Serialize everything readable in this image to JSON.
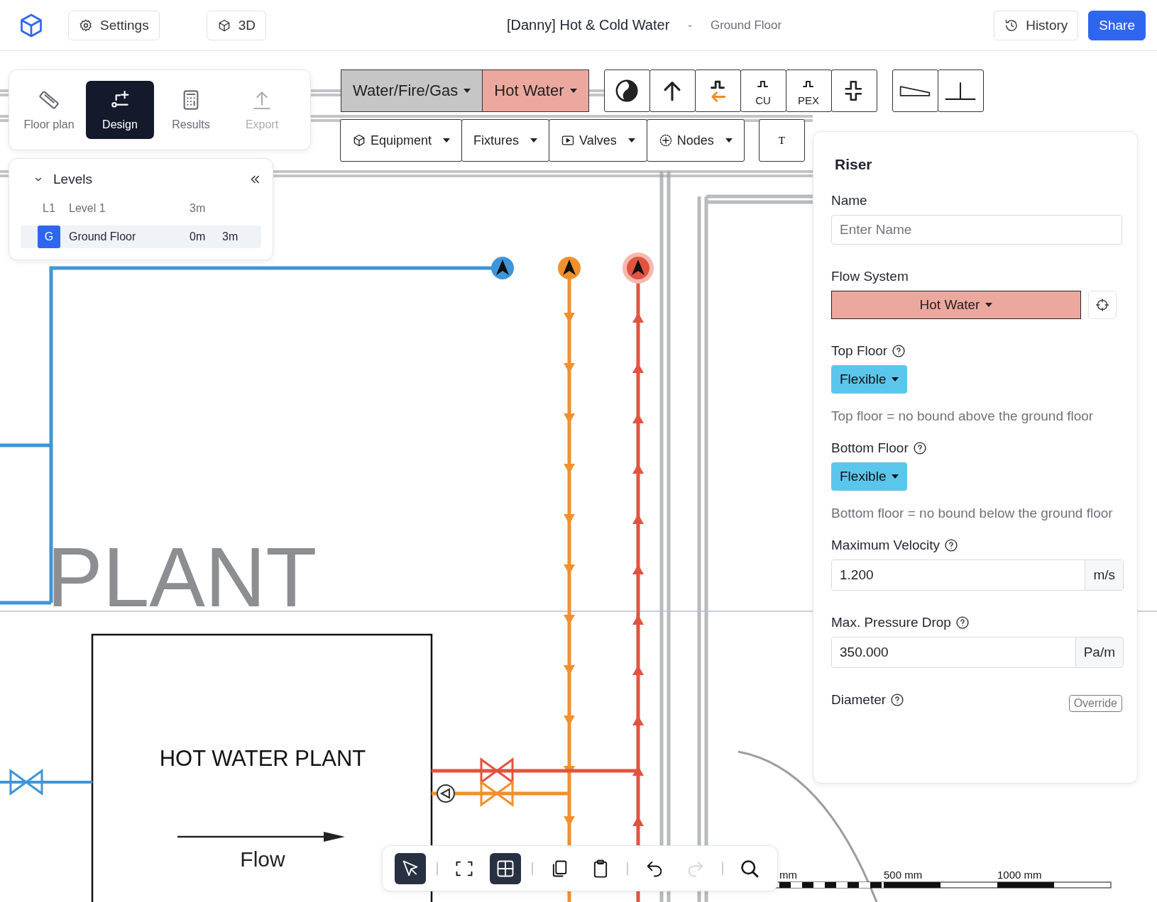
{
  "header": {
    "left_buttons": [
      {
        "label": "Settings",
        "kind": "gear"
      },
      {
        "label": "3D",
        "kind": "cube"
      }
    ],
    "title": "[Danny] Hot & Cold Water",
    "separator": "-",
    "subtitle": "Ground Floor",
    "right_buttons": [
      {
        "label": "History",
        "kind": "history",
        "primary": false
      },
      {
        "label": "Share",
        "kind": "none",
        "primary": true
      }
    ]
  },
  "modes": [
    {
      "label": "Floor plan",
      "kind": "ruler",
      "selected": false,
      "disabled": false
    },
    {
      "label": "Design",
      "kind": "design",
      "selected": true,
      "disabled": false
    },
    {
      "label": "Results",
      "kind": "calculator",
      "selected": false,
      "disabled": false
    },
    {
      "label": "Export",
      "kind": "upload",
      "selected": false,
      "disabled": true
    }
  ],
  "levels": {
    "title": "Levels",
    "expanded": true,
    "items": [
      {
        "code": "L1",
        "name": "Level 1",
        "elevation": "3m",
        "selected": false
      },
      {
        "code": "G",
        "name": "Ground Floor",
        "elevation": "0m",
        "height": "3m",
        "selected": true
      }
    ]
  },
  "toolbar": {
    "system_menus": [
      {
        "label": "Water/Fire/Gas",
        "color": "#c6c6c6"
      },
      {
        "label": "Hot Water",
        "color": "#eca89e"
      }
    ],
    "tool_groups": [
      [
        {
          "kind": "contrast"
        },
        {
          "kind": "up-arrow"
        },
        {
          "kind": "return-pipe"
        },
        {
          "kind": "pipe",
          "label": "CU"
        },
        {
          "kind": "pipe",
          "label": "PEX"
        },
        {
          "kind": "split-pipe"
        }
      ],
      [
        {
          "kind": "ramp"
        },
        {
          "kind": "perpendicular"
        }
      ]
    ],
    "insert_menus": [
      {
        "label": "Equipment",
        "kind": "cube"
      },
      {
        "label": "Fixtures",
        "kind": "none"
      },
      {
        "label": "Valves",
        "kind": "play"
      },
      {
        "label": "Nodes",
        "kind": "plus-circle"
      }
    ],
    "text_tool": "T"
  },
  "properties": {
    "title": "Riser",
    "fields": [
      {
        "kind": "text",
        "label": "Name",
        "help": false,
        "placeholder": "Enter Name"
      },
      {
        "kind": "system",
        "label": "Flow System",
        "help": false,
        "value": "Hot Water",
        "color": "#eca89e"
      },
      {
        "kind": "dropdown",
        "label": "Top Floor",
        "help": true,
        "value": "Flexible",
        "hint": "Top floor = no bound above the ground floor"
      },
      {
        "kind": "dropdown",
        "label": "Bottom Floor",
        "help": true,
        "value": "Flexible",
        "hint": "Bottom floor = no bound below the ground floor"
      },
      {
        "kind": "unit",
        "label": "Maximum Velocity",
        "help": true,
        "value": "1.200",
        "unit": "m/s"
      },
      {
        "kind": "unit",
        "label": "Max. Pressure Drop",
        "help": true,
        "value": "350.000",
        "unit": "Pa/m"
      },
      {
        "kind": "override",
        "label": "Diameter",
        "help": true,
        "button": "Override"
      }
    ]
  },
  "bottom_toolbar": [
    [
      {
        "kind": "select",
        "selected": true,
        "disabled": false
      }
    ],
    [
      {
        "kind": "fit",
        "selected": false,
        "disabled": false
      },
      {
        "kind": "grid",
        "selected": true,
        "disabled": false
      }
    ],
    [
      {
        "kind": "copy",
        "selected": false,
        "disabled": false
      },
      {
        "kind": "paste",
        "selected": false,
        "disabled": false
      }
    ],
    [
      {
        "kind": "undo",
        "selected": false,
        "disabled": false
      },
      {
        "kind": "redo",
        "selected": false,
        "disabled": true
      }
    ],
    [
      {
        "kind": "search",
        "selected": false,
        "disabled": false
      }
    ]
  ],
  "canvas": {
    "plan_labels": [
      "PLANT"
    ],
    "plant_title": "HOT WATER PLANT",
    "flow_label": "Flow",
    "scale_labels": [
      "mm",
      "500 mm",
      "1000 mm"
    ]
  }
}
